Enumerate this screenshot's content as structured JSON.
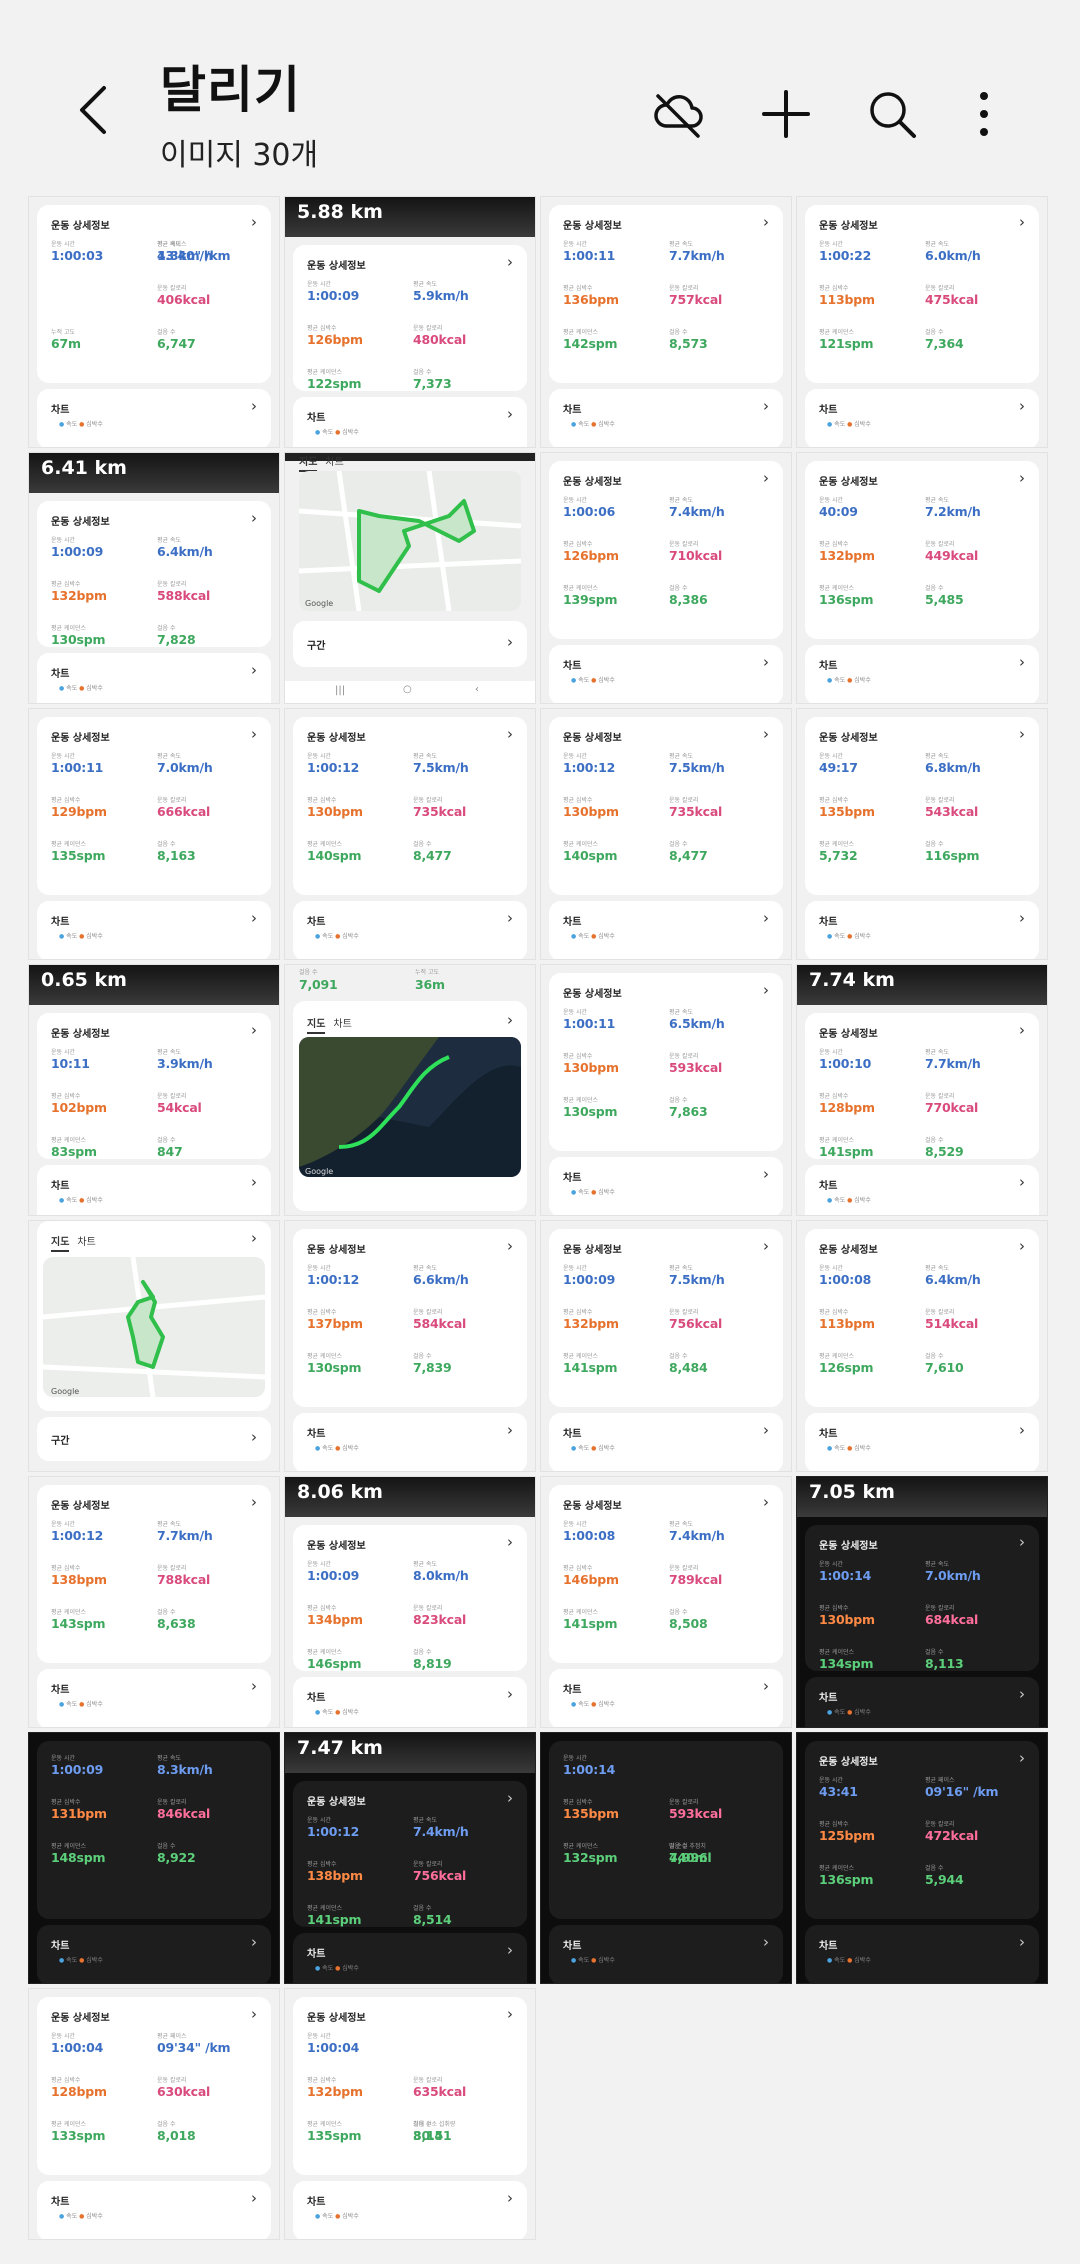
{
  "header": {
    "title": "달리기",
    "subtitle": "이미지 30개",
    "icons": [
      "back-arrow-icon",
      "cloud-off-icon",
      "plus-icon",
      "search-icon",
      "more-vertical-icon"
    ]
  },
  "common": {
    "detail_title": "운동 상세정보",
    "chart_label": "차트",
    "map_tab": "지도",
    "chart_tab": "차트",
    "section_label": "구간",
    "legend_speed": "속도",
    "legend_hr": "심박수",
    "legend_pace": "페이스",
    "lbl_time": "운동 시간",
    "lbl_speed": "평균 속도",
    "lbl_hr": "평균 심박수",
    "lbl_kcal": "운동 칼로리",
    "lbl_cadence": "평균 케이던스",
    "lbl_steps": "걸음 수",
    "lbl_elev": "누적 고도",
    "lbl_pace": "평균 페이스",
    "lbl_sweat": "땀 손실 추정치",
    "lbl_vo2": "최대 산소 섭취량",
    "map_label_google": "Google"
  },
  "colors": {
    "blue": "#3c6fc4",
    "pink": "#d94b7c",
    "orange": "#e7722d",
    "green": "#3ea85e"
  },
  "tiles": [
    {
      "time": "1:00:03",
      "speed": "4.3km/h",
      "kcal": "406kcal",
      "steps": "6,747",
      "elev": "67m",
      "pace": "13'40\" /km"
    },
    {
      "banner": "5.88 km",
      "time": "1:00:09",
      "speed": "5.9km/h",
      "hr": "126bpm",
      "kcal": "480kcal",
      "cadence": "122spm",
      "steps": "7,373"
    },
    {
      "time": "1:00:11",
      "speed": "7.7km/h",
      "hr": "136bpm",
      "kcal": "757kcal",
      "cadence": "142spm",
      "steps": "8,573"
    },
    {
      "time": "1:00:22",
      "speed": "6.0km/h",
      "hr": "113bpm",
      "kcal": "475kcal",
      "cadence": "121spm",
      "steps": "7,364"
    },
    {
      "banner": "6.41 km",
      "time": "1:00:09",
      "speed": "6.4km/h",
      "hr": "132bpm",
      "kcal": "588kcal",
      "cadence": "130spm",
      "steps": "7,828"
    },
    {
      "map": true
    },
    {
      "time": "1:00:06",
      "speed": "7.4km/h",
      "hr": "126bpm",
      "kcal": "710kcal",
      "cadence": "139spm",
      "steps": "8,386"
    },
    {
      "time": "40:09",
      "speed": "7.2km/h",
      "hr": "132bpm",
      "kcal": "449kcal",
      "cadence": "136spm",
      "steps": "5,485"
    },
    {
      "time": "1:00:11",
      "speed": "7.0km/h",
      "hr": "129bpm",
      "kcal": "666kcal",
      "cadence": "135spm",
      "steps": "8,163"
    },
    {
      "time": "1:00:12",
      "speed": "7.5km/h",
      "hr": "130bpm",
      "kcal": "735kcal",
      "cadence": "140spm",
      "steps": "8,477"
    },
    {
      "time": "1:00:12",
      "speed": "7.5km/h",
      "hr": "130bpm",
      "kcal": "735kcal",
      "cadence": "140spm",
      "steps": "8,477"
    },
    {
      "time": "49:17",
      "speed": "6.8km/h",
      "hr": "135bpm",
      "kcal": "543kcal",
      "cadence": "5,732",
      "steps": "116spm"
    },
    {
      "banner": "0.65 km",
      "time": "10:11",
      "speed": "3.9km/h",
      "hr": "102bpm",
      "kcal": "54kcal",
      "cadence": "83spm",
      "steps": "847"
    },
    {
      "sat_map": true,
      "steps_top": "7,091",
      "elev_top": "36m"
    },
    {
      "time": "1:00:11",
      "speed": "6.5km/h",
      "hr": "130bpm",
      "kcal": "593kcal",
      "cadence": "130spm",
      "steps": "7,863"
    },
    {
      "banner": "7.74 km",
      "time": "1:00:10",
      "speed": "7.7km/h",
      "hr": "128bpm",
      "kcal": "770kcal",
      "cadence": "141spm",
      "steps": "8,529"
    },
    {
      "map2": true
    },
    {
      "time": "1:00:12",
      "speed": "6.6km/h",
      "hr": "137bpm",
      "kcal": "584kcal",
      "cadence": "130spm",
      "steps": "7,839"
    },
    {
      "time": "1:00:09",
      "speed": "7.5km/h",
      "hr": "132bpm",
      "kcal": "756kcal",
      "cadence": "141spm",
      "steps": "8,484"
    },
    {
      "time": "1:00:08",
      "speed": "6.4km/h",
      "hr": "113bpm",
      "kcal": "514kcal",
      "cadence": "126spm",
      "steps": "7,610"
    },
    {
      "time": "1:00:12",
      "speed": "7.7km/h",
      "hr": "138bpm",
      "kcal": "788kcal",
      "cadence": "143spm",
      "steps": "8,638"
    },
    {
      "banner": "8.06 km",
      "time": "1:00:09",
      "speed": "8.0km/h",
      "hr": "134bpm",
      "kcal": "823kcal",
      "cadence": "146spm",
      "steps": "8,819"
    },
    {
      "time": "1:00:08",
      "speed": "7.4km/h",
      "hr": "146bpm",
      "kcal": "789kcal",
      "cadence": "141spm",
      "steps": "8,508"
    },
    {
      "banner": "7.05 km",
      "dark": true,
      "time": "1:00:14",
      "speed": "7.0km/h",
      "hr": "130bpm",
      "kcal": "684kcal",
      "cadence": "134spm",
      "steps": "8,113"
    },
    {
      "dark": true,
      "time": "1:00:09",
      "speed": "8.3km/h",
      "hr": "131bpm",
      "kcal": "846kcal",
      "cadence": "148spm",
      "steps": "8,922"
    },
    {
      "banner": "7.47 km",
      "dark": true,
      "time": "1:00:12",
      "speed": "7.4km/h",
      "hr": "138bpm",
      "kcal": "756kcal",
      "cadence": "141spm",
      "steps": "8,514"
    },
    {
      "dark": true,
      "time": "1:00:14",
      "hr": "135bpm",
      "kcal": "593kcal",
      "steps": "7,996",
      "cadence": "132spm",
      "sweat": "440ml"
    },
    {
      "dark": true,
      "time": "43:41",
      "pace": "09'16\" /km",
      "hr": "125bpm",
      "kcal": "472kcal",
      "cadence": "136spm",
      "steps": "5,944"
    },
    {
      "time": "1:00:04",
      "pace": "09'34\" /km",
      "hr": "128bpm",
      "kcal": "630kcal",
      "cadence": "133spm",
      "steps": "8,018"
    },
    {
      "time": "1:00:04",
      "hr": "132bpm",
      "kcal": "635kcal",
      "cadence": "135spm",
      "steps": "8,141",
      "vo2": "30.5"
    }
  ]
}
